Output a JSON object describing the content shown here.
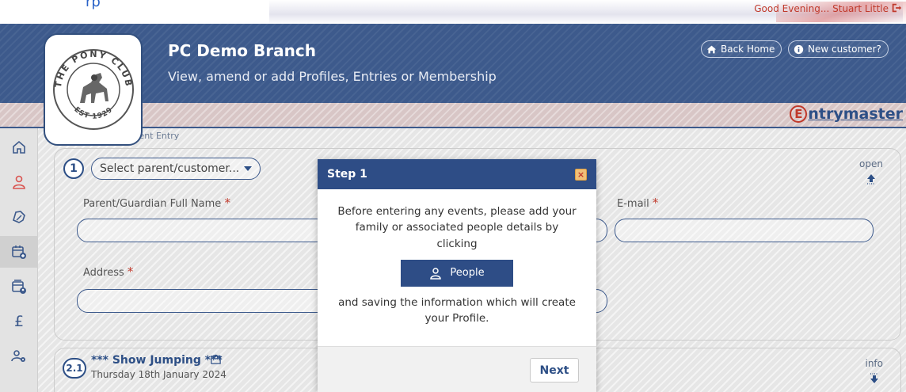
{
  "top_bar": {
    "greeting": "Good Evening... Stuart Little",
    "clipped_link": "rp"
  },
  "header": {
    "branch_title": "PC Demo Branch",
    "subtitle": "View, amend or add Profiles, Entries or Membership",
    "back_home_label": "Back Home",
    "new_customer_label": "New customer?",
    "logo_text_top": "THE PONY CLUB",
    "logo_text_bottom": "EST 1929"
  },
  "brand": {
    "e_letter": "E",
    "rest": "ntrymaster"
  },
  "sidebar": {
    "icons": [
      "home-icon",
      "person-icon",
      "rosette-icon",
      "calendar-add-icon",
      "calendar-user-icon",
      "pound-icon",
      "users-settings-icon"
    ],
    "pound_symbol": "£"
  },
  "breadcrumb": {
    "text": "> Events > PC Event Entry"
  },
  "step1": {
    "number": "1",
    "select_placeholder": "Select parent/customer...",
    "open_label": "open",
    "fields": {
      "name_label": "Parent/Guardian Full Name",
      "email_label": "E-mail",
      "address_label": "Address",
      "required_mark": "*"
    }
  },
  "step2": {
    "number": "2.1",
    "title": "*** Show Jumping ***",
    "date": "Thursday 18th January 2024",
    "info_label": "info"
  },
  "modal": {
    "title": "Step 1",
    "close_glyph": "×",
    "text_before": "Before entering any events, please add your family or associated people details by clicking",
    "people_button": "People",
    "text_after": "and saving the information which will create your Profile.",
    "next_button": "Next"
  },
  "colors": {
    "brand_blue": "#3d5a8c",
    "modal_blue": "#2e4d86",
    "required_red": "#c0392b",
    "greeting_red": "#c0392b"
  }
}
